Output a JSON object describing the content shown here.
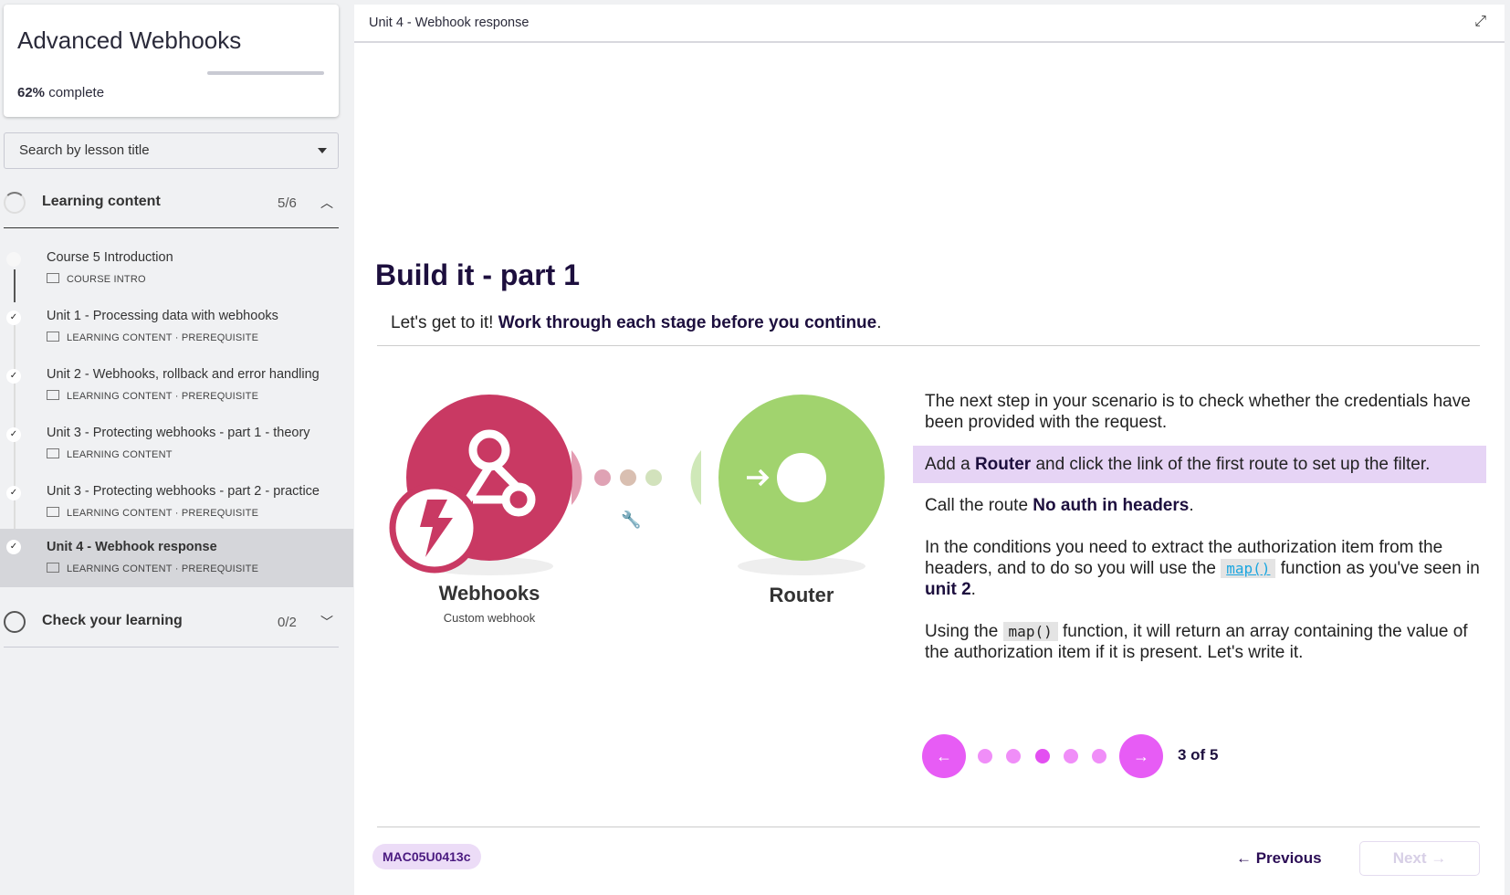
{
  "course": {
    "title": "Advanced Webhooks",
    "progress_percent": 62,
    "progress_value": "62%",
    "progress_suffix": "complete"
  },
  "search": {
    "placeholder": "Search by lesson title"
  },
  "sections": [
    {
      "label": "Learning content",
      "count": "5/6",
      "expanded": true
    },
    {
      "label": "Check your learning",
      "count": "0/2",
      "expanded": false
    }
  ],
  "lessons": [
    {
      "title": "Course 5 Introduction",
      "meta": "COURSE INTRO",
      "done": false
    },
    {
      "title": "Unit 1 - Processing data with webhooks",
      "meta": "LEARNING CONTENT · PREREQUISITE",
      "done": true
    },
    {
      "title": "Unit 2 - Webhooks, rollback and error handling",
      "meta": "LEARNING CONTENT · PREREQUISITE",
      "done": true
    },
    {
      "title": "Unit 3 - Protecting webhooks - part 1 - theory",
      "meta": "LEARNING CONTENT",
      "done": true
    },
    {
      "title": "Unit 3 - Protecting webhooks - part 2 - practice",
      "meta": "LEARNING CONTENT · PREREQUISITE",
      "done": true
    },
    {
      "title": "Unit 4 - Webhook response",
      "meta": "LEARNING CONTENT · PREREQUISITE",
      "done": true,
      "active": true
    }
  ],
  "main": {
    "header": "Unit 4 - Webhook response",
    "title": "Build it - part 1",
    "subtitle_a": "Let's get to it! ",
    "subtitle_b": "Work through each stage before you continue",
    "diagram": {
      "node1": "Webhooks",
      "node1_sub": "Custom webhook",
      "node2": "Router"
    },
    "p1": "The next step in your scenario is to check whether the credentials have been provided with the request.",
    "p2a": "Add a ",
    "p2b": "Router",
    "p2c": " and click the link of the first route to set up the filter.",
    "p3a": "Call the route ",
    "p3b": "No auth in headers",
    "p4a": "In the conditions you need to extract the authorization item from the headers, and to do so you will use the ",
    "p4code": "map()",
    "p4b": " function as you've seen in ",
    "p4c": "unit 2",
    "p5a": "Using the ",
    "p5code": "map()",
    "p5b": " function, it will return an array containing the value of the authorization item if it is present. Let's write it.",
    "carousel": {
      "current": 3,
      "total": 5,
      "label": "3 of 5"
    },
    "badge": "MAC05U0413c",
    "previous": "← Previous",
    "next": "Next →"
  },
  "colors": {
    "accent": "#e75cf5",
    "highlight": "#e6d4f5",
    "webhook": "#c93963",
    "router": "#a1d36e"
  }
}
